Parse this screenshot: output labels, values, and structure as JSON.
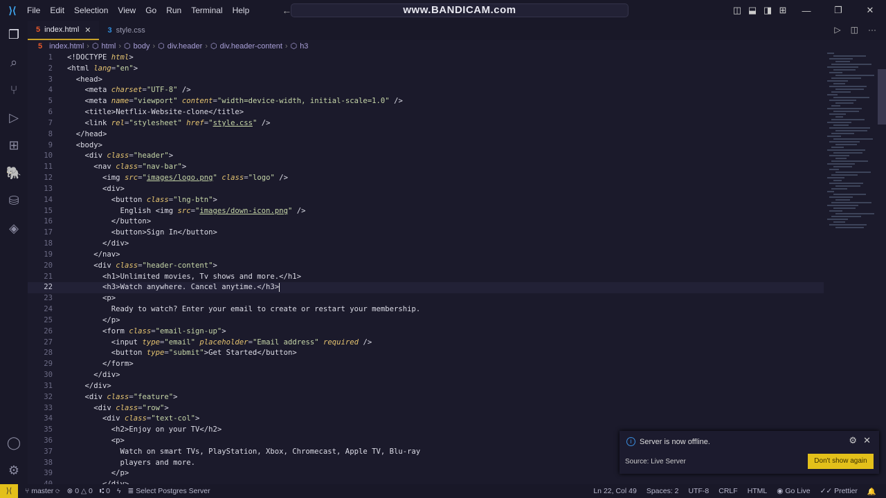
{
  "menu": [
    "File",
    "Edit",
    "Selection",
    "View",
    "Go",
    "Run",
    "Terminal",
    "Help"
  ],
  "command_center": "www.BANDICAM.com",
  "tabs": [
    {
      "label": "index.html",
      "icon": "html5-icon",
      "active": true
    },
    {
      "label": "style.css",
      "icon": "css3-icon",
      "active": false
    }
  ],
  "breadcrumb": [
    "index.html",
    "html",
    "body",
    "div.header",
    "div.header-content",
    "h3"
  ],
  "editor": {
    "current_line": 22,
    "lines": [
      "<!DOCTYPE html>",
      "<html lang=\"en\">",
      "  <head>",
      "    <meta charset=\"UTF-8\" />",
      "    <meta name=\"viewport\" content=\"width=device-width, initial-scale=1.0\" />",
      "    <title>Netflix-Website-clone</title>",
      "    <link rel=\"stylesheet\" href=\"style.css\" />",
      "  </head>",
      "  <body>",
      "    <div class=\"header\">",
      "      <nav class=\"nav-bar\">",
      "        <img src=\"images/logo.png\" class=\"logo\" />",
      "        <div>",
      "          <button class=\"lng-btn\">",
      "            English <img src=\"images/down-icon.png\" />",
      "          </button>",
      "          <button>Sign In</button>",
      "        </div>",
      "      </nav>",
      "      <div class=\"header-content\">",
      "        <h1>Unlimited movies, Tv shows and more.</h1>",
      "        <h3>Watch anywhere. Cancel anytime.</h3>",
      "        <p>",
      "          Ready to watch? Enter your email to create or restart your membership.",
      "        </p>",
      "        <form class=\"email-sign-up\">",
      "          <input type=\"email\" placeholder=\"Email address\" required />",
      "          <button type=\"submit\">Get Started</button>",
      "        </form>",
      "      </div>",
      "    </div>",
      "    <div class=\"feature\">",
      "      <div class=\"row\">",
      "        <div class=\"text-col\">",
      "          <h2>Enjoy on your TV</h2>",
      "          <p>",
      "            Watch on smart TVs, PlayStation, Xbox, Chromecast, Apple TV, Blu-ray",
      "            players and more.",
      "          </p>",
      "        </div>"
    ]
  },
  "notification": {
    "message": "Server is now offline.",
    "source": "Source: Live Server",
    "button": "Don't show again"
  },
  "status": {
    "branch": "master",
    "errors": "0",
    "warnings": "0",
    "ports": "0",
    "postgres": "Select Postgres Server",
    "position": "Ln 22, Col 49",
    "spaces": "Spaces: 2",
    "encoding": "UTF-8",
    "eol": "CRLF",
    "language": "HTML",
    "golive": "Go Live",
    "prettier": "Prettier"
  },
  "colors": {
    "background": "#1b1a2b",
    "accent": "#e3c01a",
    "attribute": "#e6c470",
    "string": "#c6d6a8"
  }
}
